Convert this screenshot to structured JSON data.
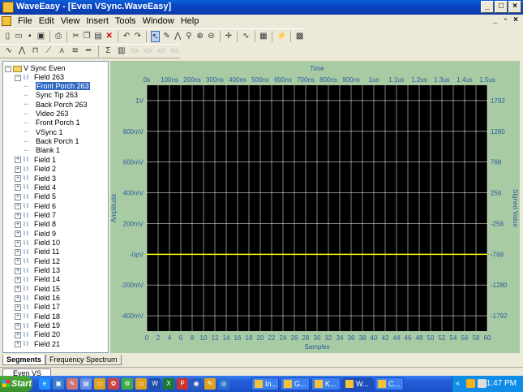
{
  "window": {
    "title": "WaveEasy - [Even VSync.WaveEasy]",
    "minimize": "_",
    "maximize": "□",
    "close": "×"
  },
  "menu": {
    "items": [
      "File",
      "Edit",
      "View",
      "Insert",
      "Tools",
      "Window",
      "Help"
    ]
  },
  "tree": {
    "root": "V Sync Even",
    "field263": "Field 263",
    "segments": [
      "Front Porch 263",
      "Sync Tip 263",
      "Back Porch 263",
      "Video 263",
      "Front Porch 1",
      "VSync 1",
      "Back Porch 1",
      "Blank 1"
    ],
    "selected_segment": "Front Porch 263",
    "fields": [
      "Field 1",
      "Field 2",
      "Field 3",
      "Field 4",
      "Field 5",
      "Field 6",
      "Field 7",
      "Field 8",
      "Field 9",
      "Field 10",
      "Field 11",
      "Field 12",
      "Field 13",
      "Field 14",
      "Field 15",
      "Field 16",
      "Field 17",
      "Field 18",
      "Field 19",
      "Field 20",
      "Field 21"
    ]
  },
  "chart_data": {
    "type": "line",
    "title": "Time",
    "xlabel": "Samples",
    "ylabel": "Amplitude",
    "y2label": "Signed Value",
    "top_ticks": [
      "0s",
      "100ns",
      "200ns",
      "300ns",
      "400ns",
      "500ns",
      "600ns",
      "700ns",
      "800ns",
      "900ns",
      "1us",
      "1.1us",
      "1.2us",
      "1.3us",
      "1.4us",
      "1.5us"
    ],
    "x_ticks": [
      0,
      2,
      4,
      6,
      8,
      10,
      12,
      14,
      16,
      18,
      20,
      22,
      24,
      26,
      28,
      30,
      32,
      34,
      36,
      38,
      40,
      42,
      44,
      46,
      48,
      50,
      52,
      54,
      56,
      58,
      60
    ],
    "xlim": [
      0,
      60
    ],
    "ylim": [
      -0.5,
      1.1
    ],
    "y_ticks": [
      {
        "value": 1.0,
        "label": "1V"
      },
      {
        "value": 0.8,
        "label": "800mV"
      },
      {
        "value": 0.6,
        "label": "600mV"
      },
      {
        "value": 0.4,
        "label": "400mV"
      },
      {
        "value": 0.2,
        "label": "200mV"
      },
      {
        "value": 0.0,
        "label": "-0pV"
      },
      {
        "value": -0.2,
        "label": "-200mV"
      },
      {
        "value": -0.4,
        "label": "-400mV"
      }
    ],
    "y2_ticks": [
      "1792",
      "1280",
      "768",
      "256",
      "-256",
      "-768",
      "-1280",
      "-1792"
    ],
    "series": [
      {
        "x": [
          0,
          60
        ],
        "y": [
          0,
          0
        ],
        "color": "#ffff00"
      }
    ],
    "grid": true,
    "plot_bg": "#000000",
    "panel_bg": "#a9cba3",
    "label_color": "#2b5da0"
  },
  "tabs": [
    "Segments",
    "Frequency Spectrum"
  ],
  "mdi_tab": "Even VS",
  "taskbar": {
    "start": "Start",
    "tasks": [
      "In...",
      "G...",
      "K...",
      "W...",
      "C..."
    ],
    "clock": "1:47 PM"
  }
}
